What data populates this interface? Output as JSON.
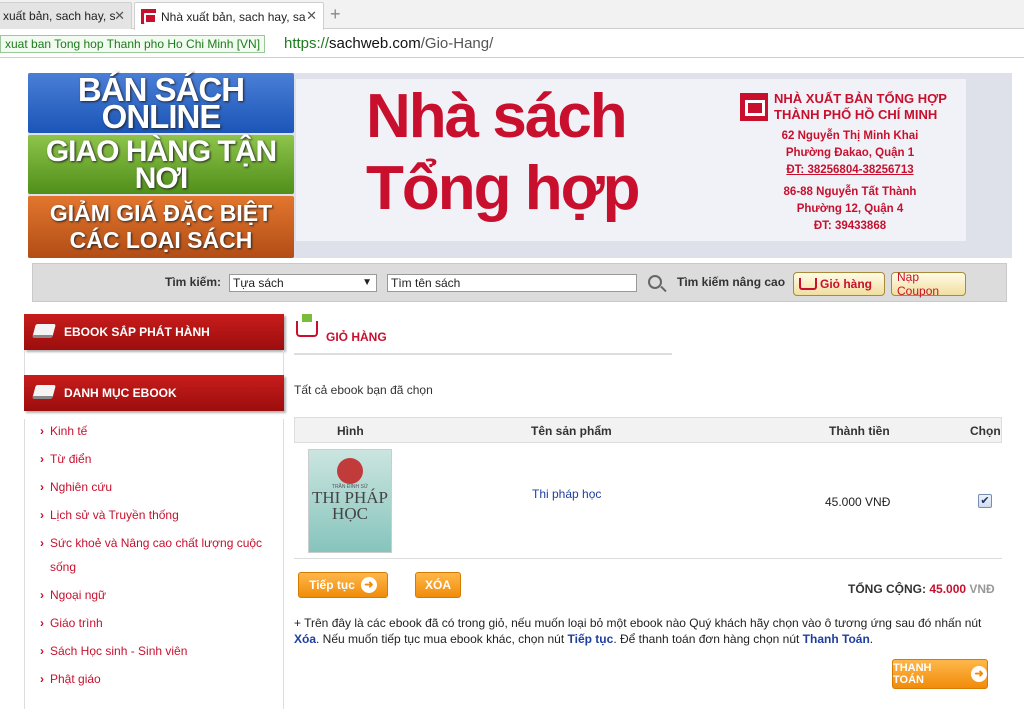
{
  "browser": {
    "tabs": [
      {
        "title": "xuất bản, sach hay, sa"
      },
      {
        "title": "Nhà xuất bản, sach hay, sa"
      }
    ],
    "ev_badge": "xuat ban Tong hop Thanh pho Ho Chi Minh [VN]",
    "url_scheme": "https://",
    "url_host": "sachweb.com",
    "url_path": "/Gio-Hang/"
  },
  "banner": {
    "tile1": "BÁN SÁCH ONLINE",
    "tile2": "GIAO HÀNG TẬN NƠI",
    "tile3_line1": "GIẢM GIÁ ĐẶC BIỆT",
    "tile3_line2": "CÁC LOẠI SÁCH",
    "title_line1": "Nhà sách",
    "title_line2": "Tổng hợp",
    "publisher_line1": "NHÀ XUẤT BẢN TỔNG HỢP",
    "publisher_line2": "THÀNH PHỐ HỒ CHÍ MINH",
    "addr1_line1": "62 Nguyễn Thị Minh Khai",
    "addr1_line2": "Phường Đakao, Quận 1",
    "addr1_phone": "ĐT: 38256804-38256713",
    "addr2_line1": "86-88 Nguyễn Tất Thành",
    "addr2_line2": "Phường 12, Quận 4",
    "addr2_phone": "ĐT: 39433868"
  },
  "search": {
    "label": "Tìm kiếm:",
    "select_value": "Tựa sách",
    "input_value": "Tìm tên sách",
    "advanced": "Tìm kiếm nâng cao",
    "cart_button": "Giỏ hàng",
    "coupon_button": "Nạp Coupon"
  },
  "sidebar": {
    "section1": "EBOOK SẮP PHÁT HÀNH",
    "section2": "DANH MỤC EBOOK",
    "items": [
      {
        "label": "Kinh tế"
      },
      {
        "label": "Từ điển"
      },
      {
        "label": "Nghiên cứu"
      },
      {
        "label": "Lịch sử và Truyền thống"
      },
      {
        "label": "Sức khoẻ và Nâng cao chất lượng cuộc sống"
      },
      {
        "label": "Ngoại ngữ"
      },
      {
        "label": "Giáo trình"
      },
      {
        "label": "Sách Học sinh - Sinh viên"
      },
      {
        "label": "Phật giáo"
      }
    ]
  },
  "cart": {
    "title": "GIỎ HÀNG",
    "intro": "Tất cả ebook bạn đã chọn",
    "columns": [
      "Hình",
      "Tên sản phẩm",
      "Thành tiền",
      "Chọn"
    ],
    "rows": [
      {
        "name": "Thi pháp học",
        "price": "45.000 VNĐ",
        "checked": true,
        "cover_title": "THI PHÁP HỌC",
        "cover_author": "TRẦN ĐÌNH SỬ"
      }
    ],
    "continue_button": "Tiếp tục",
    "delete_button": "XÓA",
    "total_label": "TỔNG CỘNG:",
    "total_value": "45.000",
    "total_unit": "VNĐ",
    "note_part1": "+ Trên đây là các ebook đã có trong giỏ, nếu muốn loại bỏ một ebook nào Quý khách hãy chọn vào ô tương ứng sau đó nhấn nút",
    "note_xoa": "Xóa",
    "note_part2": ". Nếu muốn tiếp tục mua ebook khác, chọn nút",
    "note_tieptuc": "Tiếp tục",
    "note_part3": ". Để thanh toán đơn hàng chọn nút",
    "note_thanhtoan": "Thanh Toán",
    "note_end": ".",
    "checkout_button": "THANH TOÁN"
  },
  "colors": {
    "brand_red": "#c8102e",
    "accent_orange": "#f08c0a",
    "link_blue": "#1f3f9f"
  }
}
